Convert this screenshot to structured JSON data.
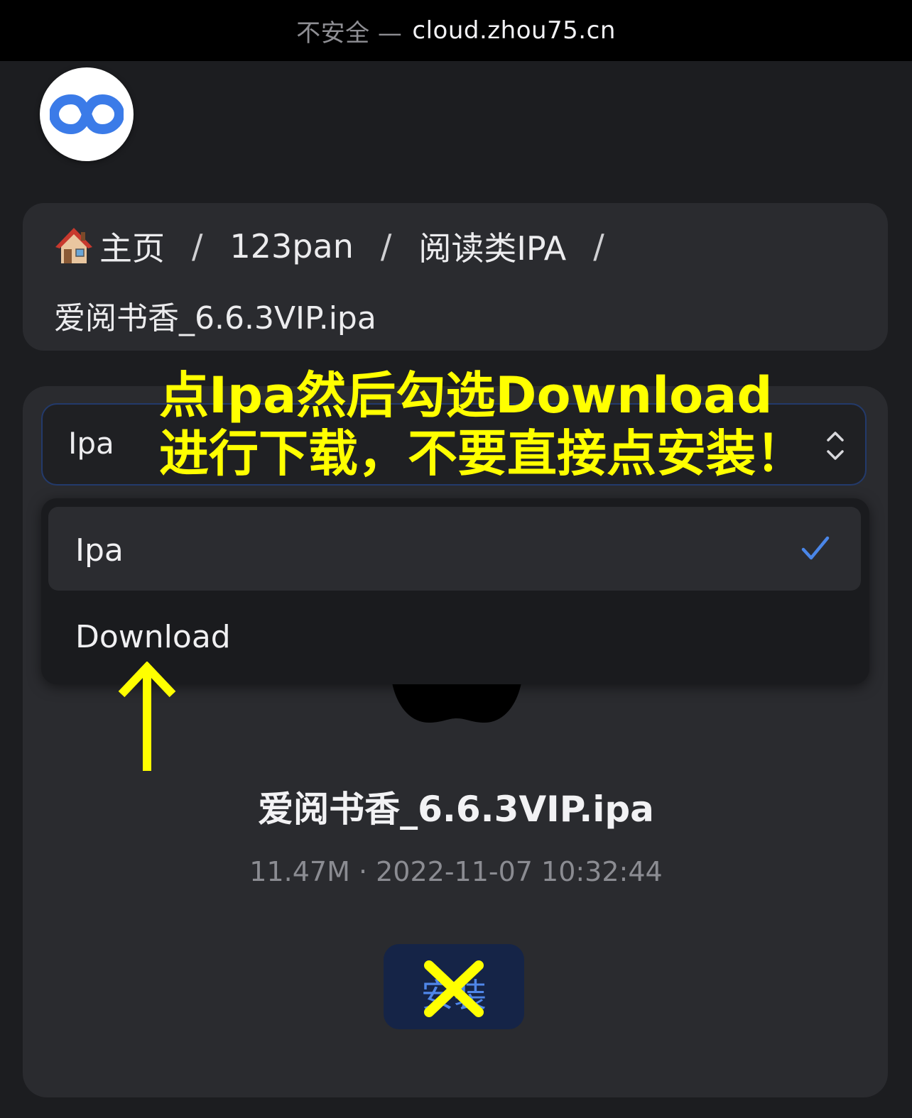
{
  "urlbar": {
    "insecure": "不安全 —",
    "domain": "cloud.zhou75.cn"
  },
  "logo": {
    "icon": "infinity-logo-icon",
    "color": "#3b7be8"
  },
  "breadcrumb": {
    "home_icon": "house-icon",
    "items": [
      "主页",
      "123pan",
      "阅读类IPA"
    ],
    "separator": "/",
    "current": "爱阅书香_6.6.3VIP.ipa"
  },
  "select": {
    "value": "Ipa",
    "options": [
      {
        "label": "Ipa",
        "selected": true
      },
      {
        "label": "Download",
        "selected": false
      }
    ],
    "accent": "#4a86e8"
  },
  "file": {
    "name": "爱阅书香_6.6.3VIP.ipa",
    "meta": "11.47M · 2022-11-07 10:32:44"
  },
  "install_button": {
    "label": "安装",
    "bg": "#152447",
    "color": "#4f86e8"
  },
  "annotation": {
    "line1": "点Ipa然后勾选Download",
    "line2": "进行下载，不要直接点安装！",
    "color": "#ffff00"
  }
}
